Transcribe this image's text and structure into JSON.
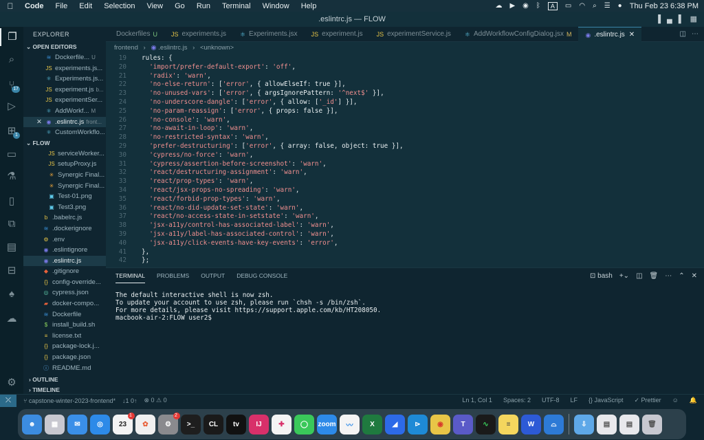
{
  "menubar": {
    "apple": "",
    "items": [
      "Code",
      "File",
      "Edit",
      "Selection",
      "View",
      "Go",
      "Run",
      "Terminal",
      "Window",
      "Help"
    ],
    "clock": "Thu Feb 23  6:38 PM",
    "input_indicator": "A"
  },
  "window": {
    "title": ".eslintrc.js — FLOW"
  },
  "activitybar": {
    "items": [
      {
        "name": "explorer-icon",
        "glyph": "❐"
      },
      {
        "name": "search-icon",
        "glyph": "⌕"
      },
      {
        "name": "source-control-icon",
        "glyph": "⑂",
        "badge": "17"
      },
      {
        "name": "run-debug-icon",
        "glyph": "▷"
      },
      {
        "name": "extensions-icon",
        "glyph": "⊞",
        "badge": "1"
      },
      {
        "name": "remote-explorer-icon",
        "glyph": "▭"
      },
      {
        "name": "testing-icon",
        "glyph": "⚗"
      },
      {
        "name": "bookmarks-icon",
        "glyph": "▯"
      },
      {
        "name": "docker-containers-icon",
        "glyph": "⧉"
      },
      {
        "name": "notes-icon",
        "glyph": "▤"
      },
      {
        "name": "database-icon",
        "glyph": "⊟"
      },
      {
        "name": "mongodb-icon",
        "glyph": "♠"
      },
      {
        "name": "docker-icon",
        "glyph": "☁"
      }
    ],
    "settings_glyph": "⚙"
  },
  "sidebar": {
    "title": "EXPLORER",
    "open_editors_label": "OPEN EDITORS",
    "open_editors": [
      {
        "icon": "docker-file-icon",
        "glyph": "≋",
        "color": "#3a8fd6",
        "label": "Dockerfile...",
        "suffix": "U",
        "selected": false
      },
      {
        "icon": "js-file-icon",
        "glyph": "JS",
        "color": "#e8c547",
        "label": "experiments.js...",
        "suffix": "",
        "selected": false
      },
      {
        "icon": "react-file-icon",
        "glyph": "⚛",
        "color": "#5ec8e8",
        "label": "Experiments.js...",
        "suffix": "",
        "selected": false
      },
      {
        "icon": "js-file-icon",
        "glyph": "JS",
        "color": "#e8c547",
        "label": "experiment.js",
        "suffix": "b...",
        "selected": false
      },
      {
        "icon": "js-file-icon",
        "glyph": "JS",
        "color": "#e8c547",
        "label": "experimentSer...",
        "suffix": "",
        "selected": false
      },
      {
        "icon": "react-file-icon",
        "glyph": "⚛",
        "color": "#5ec8e8",
        "label": "AddWorkf...",
        "suffix": "M",
        "selected": false
      },
      {
        "icon": "eslint-file-icon",
        "glyph": "◉",
        "color": "#7a7ae8",
        "label": ".eslintrc.js",
        "suffix": "front...",
        "selected": true,
        "close": "✕"
      },
      {
        "icon": "react-file-icon",
        "glyph": "⚛",
        "color": "#5ec8e8",
        "label": "CustomWorkflo...",
        "suffix": "",
        "selected": false
      }
    ],
    "flow_label": "FLOW",
    "files": [
      {
        "icon": "js-file-icon",
        "glyph": "JS",
        "color": "#e8c547",
        "label": "serviceWorker...",
        "indent": 1,
        "selected": false
      },
      {
        "icon": "js-file-icon",
        "glyph": "JS",
        "color": "#e8c547",
        "label": "setupProxy.js",
        "indent": 1,
        "selected": false
      },
      {
        "icon": "image-file-icon",
        "glyph": "✳",
        "color": "#e8a23a",
        "label": "Synergic Final...",
        "indent": 1,
        "selected": false
      },
      {
        "icon": "image-file-icon",
        "glyph": "✳",
        "color": "#e8a23a",
        "label": "Synergic Final...",
        "indent": 1,
        "selected": false
      },
      {
        "icon": "image-file-icon",
        "glyph": "▣",
        "color": "#5ec8e8",
        "label": "Test-01.png",
        "indent": 1,
        "selected": false
      },
      {
        "icon": "image-file-icon",
        "glyph": "▣",
        "color": "#5ec8e8",
        "label": "Test3.png",
        "indent": 1,
        "selected": false
      },
      {
        "icon": "babel-file-icon",
        "glyph": "b",
        "color": "#e8c547",
        "label": ".babelrc.js",
        "indent": 0,
        "selected": false
      },
      {
        "icon": "docker-file-icon",
        "glyph": "≋",
        "color": "#3a8fd6",
        "label": ".dockerignore",
        "indent": 0,
        "selected": false
      },
      {
        "icon": "env-file-icon",
        "glyph": "⚙",
        "color": "#e8c547",
        "label": ".env",
        "indent": 0,
        "selected": false
      },
      {
        "icon": "eslint-file-icon",
        "glyph": "◉",
        "color": "#7a7ae8",
        "label": ".eslintignore",
        "indent": 0,
        "selected": false
      },
      {
        "icon": "eslint-file-icon",
        "glyph": "◉",
        "color": "#7a7ae8",
        "label": ".eslintrc.js",
        "indent": 0,
        "selected": true
      },
      {
        "icon": "git-file-icon",
        "glyph": "◆",
        "color": "#e8613a",
        "label": ".gitignore",
        "indent": 0,
        "selected": false
      },
      {
        "icon": "json-file-icon",
        "glyph": "{}",
        "color": "#e8c547",
        "label": "config-override...",
        "indent": 0,
        "selected": false
      },
      {
        "icon": "cypress-file-icon",
        "glyph": "◎",
        "color": "#5ec8a8",
        "label": "cypress.json",
        "indent": 0,
        "selected": false
      },
      {
        "icon": "docker-compose-icon",
        "glyph": "▰",
        "color": "#e8613a",
        "label": "docker-compo...",
        "indent": 0,
        "selected": false
      },
      {
        "icon": "docker-file-icon",
        "glyph": "≋",
        "color": "#3a8fd6",
        "label": "Dockerfile",
        "indent": 0,
        "selected": false
      },
      {
        "icon": "shell-file-icon",
        "glyph": "$",
        "color": "#8fd65e",
        "label": "install_build.sh",
        "indent": 0,
        "selected": false
      },
      {
        "icon": "license-file-icon",
        "glyph": "≡",
        "color": "#e8c547",
        "label": "license.txt",
        "indent": 0,
        "selected": false
      },
      {
        "icon": "npm-file-icon",
        "glyph": "{}",
        "color": "#e8c547",
        "label": "package-lock.j...",
        "indent": 0,
        "selected": false
      },
      {
        "icon": "npm-file-icon",
        "glyph": "{}",
        "color": "#e8c547",
        "label": "package.json",
        "indent": 0,
        "selected": false
      },
      {
        "icon": "markdown-file-icon",
        "glyph": "ⓘ",
        "color": "#5ea8e8",
        "label": "README.md",
        "indent": 0,
        "selected": false
      }
    ],
    "outline_label": "OUTLINE",
    "timeline_label": "TIMELINE"
  },
  "tabs": [
    {
      "label": "Dockerfiles",
      "mod": "U",
      "icon": "docker-file-icon",
      "glyph": "",
      "color": "#3a8fd6",
      "active": false
    },
    {
      "label": "experiments.js",
      "mod": "",
      "icon": "js-file-icon",
      "glyph": "JS",
      "color": "#e8c547",
      "active": false
    },
    {
      "label": "Experiments.jsx",
      "mod": "",
      "icon": "react-file-icon",
      "glyph": "⚛",
      "color": "#5ec8e8",
      "active": false
    },
    {
      "label": "experiment.js",
      "mod": "",
      "icon": "js-file-icon",
      "glyph": "JS",
      "color": "#e8c547",
      "active": false
    },
    {
      "label": "experimentService.js",
      "mod": "",
      "icon": "js-file-icon",
      "glyph": "JS",
      "color": "#e8c547",
      "active": false
    },
    {
      "label": "AddWorkflowConfigDialog.jsx",
      "mod": "M",
      "icon": "react-file-icon",
      "glyph": "⚛",
      "color": "#5ec8e8",
      "active": false
    },
    {
      "label": ".eslintrc.js",
      "mod": "",
      "icon": "eslint-file-icon",
      "glyph": "◉",
      "color": "#7a7ae8",
      "active": true
    }
  ],
  "breadcrumb": {
    "parts": [
      "frontend",
      ".eslintrc.js",
      "<unknown>"
    ]
  },
  "code": {
    "lines": [
      {
        "n": "19",
        "t": "rules: {",
        "kind": "key"
      },
      {
        "n": "20",
        "t": "  'import/prefer-default-export': 'off',",
        "kind": "rule"
      },
      {
        "n": "21",
        "t": "  'radix': 'warn',",
        "kind": "rule"
      },
      {
        "n": "22",
        "t": "  'no-else-return': ['error', { allowElseIf: true }],",
        "kind": "rule"
      },
      {
        "n": "23",
        "t": "  'no-unused-vars': ['error', { argsIgnorePattern: '^next$' }],",
        "kind": "rule"
      },
      {
        "n": "24",
        "t": "  'no-underscore-dangle': ['error', { allow: ['_id'] }],",
        "kind": "rule"
      },
      {
        "n": "25",
        "t": "  'no-param-reassign': ['error', { props: false }],",
        "kind": "rule"
      },
      {
        "n": "26",
        "t": "  'no-console': 'warn',",
        "kind": "rule"
      },
      {
        "n": "27",
        "t": "  'no-await-in-loop': 'warn',",
        "kind": "rule"
      },
      {
        "n": "28",
        "t": "  'no-restricted-syntax': 'warn',",
        "kind": "rule"
      },
      {
        "n": "29",
        "t": "  'prefer-destructuring': ['error', { array: false, object: true }],",
        "kind": "rule"
      },
      {
        "n": "30",
        "t": "  'cypress/no-force': 'warn',",
        "kind": "rule"
      },
      {
        "n": "31",
        "t": "  'cypress/assertion-before-screenshot': 'warn',",
        "kind": "rule"
      },
      {
        "n": "32",
        "t": "  'react/destructuring-assignment': 'warn',",
        "kind": "rule"
      },
      {
        "n": "33",
        "t": "  'react/prop-types': 'warn',",
        "kind": "rule"
      },
      {
        "n": "34",
        "t": "  'react/jsx-props-no-spreading': 'warn',",
        "kind": "rule"
      },
      {
        "n": "35",
        "t": "  'react/forbid-prop-types': 'warn',",
        "kind": "rule"
      },
      {
        "n": "36",
        "t": "  'react/no-did-update-set-state': 'warn',",
        "kind": "rule"
      },
      {
        "n": "37",
        "t": "  'react/no-access-state-in-setstate': 'warn',",
        "kind": "rule"
      },
      {
        "n": "38",
        "t": "  'jsx-a11y/control-has-associated-label': 'warn',",
        "kind": "rule"
      },
      {
        "n": "39",
        "t": "  'jsx-a11y/label-has-associated-control': 'warn',",
        "kind": "rule"
      },
      {
        "n": "40",
        "t": "  'jsx-a11y/click-events-have-key-events': 'error',",
        "kind": "rule"
      },
      {
        "n": "41",
        "t": "},",
        "kind": "punc"
      },
      {
        "n": "42",
        "t": "};",
        "kind": "punc"
      }
    ]
  },
  "panel": {
    "tabs": [
      "TERMINAL",
      "PROBLEMS",
      "OUTPUT",
      "DEBUG CONSOLE"
    ],
    "active_tab": "TERMINAL",
    "shell_label": "bash",
    "terminal_text": "The default interactive shell is now zsh.\nTo update your account to use zsh, please run `chsh -s /bin/zsh`.\nFor more details, please visit https://support.apple.com/kb/HT208050.\nmacbook-air-2:FLOW user2$ "
  },
  "statusbar": {
    "branch": "capstone-winter-2023-frontend*",
    "sync": "↓1 0↑",
    "problems": "⊗ 0  ⚠ 0",
    "cursor": "Ln 1, Col 1",
    "spaces": "Spaces: 2",
    "encoding": "UTF-8",
    "eol": "LF",
    "language": "{} JavaScript",
    "prettier": "✓ Prettier"
  },
  "dock": {
    "apps": [
      {
        "name": "finder-dock-icon",
        "label": "☻",
        "bg": "#3c8ce0"
      },
      {
        "name": "launchpad-dock-icon",
        "label": "▦",
        "bg": "#c8c8d0"
      },
      {
        "name": "mail-dock-icon",
        "label": "✉",
        "bg": "#3a8fe8"
      },
      {
        "name": "safari-dock-icon",
        "label": "◎",
        "bg": "#2d8ae8"
      },
      {
        "name": "calendar-dock-icon",
        "label": "23",
        "bg": "#f4f4f4",
        "badge": "1",
        "text_color": "#222"
      },
      {
        "name": "photos-dock-icon",
        "label": "✿",
        "bg": "#f0f0f0",
        "text_color": "#e8613a"
      },
      {
        "name": "system-settings-dock-icon",
        "label": "⚙",
        "bg": "#8a8a8e",
        "badge": "2"
      },
      {
        "name": "terminal-dock-icon",
        "label": ">_",
        "bg": "#1e1e1e"
      },
      {
        "name": "clion-dock-icon",
        "label": "CL",
        "bg": "#1a1a1a"
      },
      {
        "name": "apple-tv-dock-icon",
        "label": "tv",
        "bg": "#111111"
      },
      {
        "name": "intellij-dock-icon",
        "label": "IJ",
        "bg": "#d8306a"
      },
      {
        "name": "slack-dock-icon",
        "label": "✚",
        "bg": "#f4f4f4",
        "text_color": "#d8306a"
      },
      {
        "name": "messages-dock-icon",
        "label": "◯",
        "bg": "#3ac85a"
      },
      {
        "name": "zoom-dock-icon",
        "label": "zoom",
        "bg": "#2d8ae8"
      },
      {
        "name": "freeform-dock-icon",
        "label": "〰",
        "bg": "#f4f4f4",
        "text_color": "#2d8ae8"
      },
      {
        "name": "excel-dock-icon",
        "label": "X",
        "bg": "#1f7a3f"
      },
      {
        "name": "azure-data-studio-dock-icon",
        "label": "◢",
        "bg": "#2d6ae8"
      },
      {
        "name": "vscode-dock-icon",
        "label": "⊳",
        "bg": "#1e8ad6"
      },
      {
        "name": "chrome-dock-icon",
        "label": "◉",
        "bg": "#e8c547",
        "text_color": "#d83a2a"
      },
      {
        "name": "teams-dock-icon",
        "label": "T",
        "bg": "#5a5ac8"
      },
      {
        "name": "activity-monitor-dock-icon",
        "label": "∿",
        "bg": "#1a1a1a",
        "text_color": "#3ac85a"
      },
      {
        "name": "notes-dock-icon",
        "label": "≡",
        "bg": "#f4d65e",
        "text_color": "#444"
      },
      {
        "name": "word-dock-icon",
        "label": "W",
        "bg": "#2d5ad6"
      },
      {
        "name": "sofa-dock-icon",
        "label": "⌓",
        "bg": "#2d7ad6"
      },
      {
        "name": "downloads-dock-icon",
        "label": "⇩",
        "bg": "#5ea8e8",
        "after_sep": true
      },
      {
        "name": "documents-dock-icon",
        "label": "▤",
        "bg": "#e8e8ec",
        "text_color": "#555"
      },
      {
        "name": "recent-file-dock-icon",
        "label": "▤",
        "bg": "#e8e8ec",
        "text_color": "#555"
      },
      {
        "name": "trash-dock-icon",
        "label": "🗑",
        "bg": "#c8c8d0",
        "text_color": "#555"
      }
    ]
  }
}
